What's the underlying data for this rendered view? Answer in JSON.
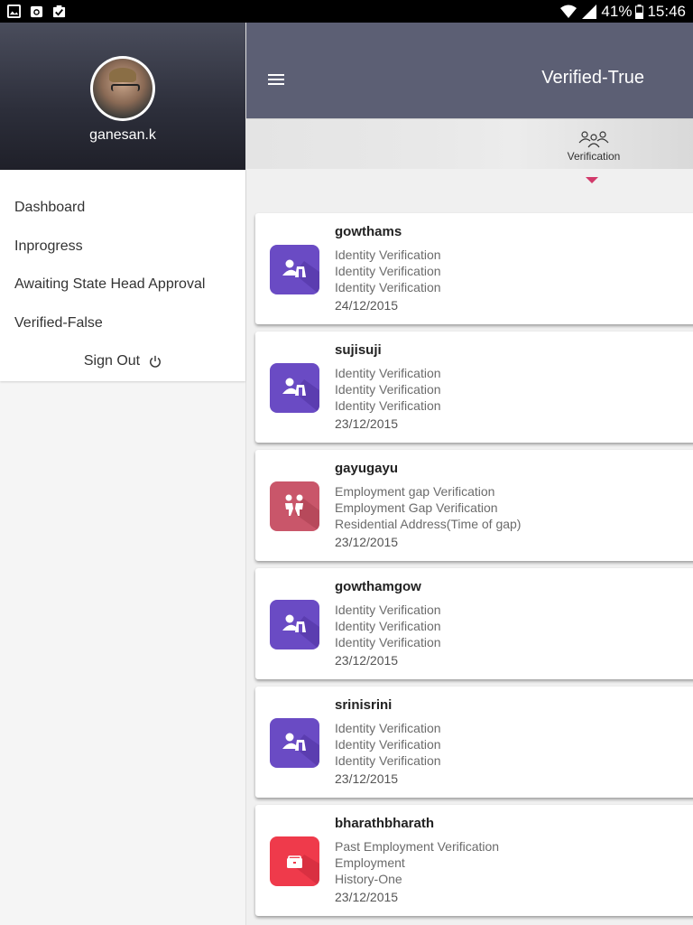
{
  "status_bar": {
    "icons_left": [
      "gallery-icon",
      "camera-icon",
      "clipboard-check-icon"
    ],
    "battery": "41%",
    "time": "15:46"
  },
  "drawer": {
    "username": "ganesan.k",
    "menu": [
      {
        "label": "Dashboard"
      },
      {
        "label": "Inprogress"
      },
      {
        "label": "Awaiting State Head Approval"
      },
      {
        "label": "Verified-False"
      }
    ],
    "sign_out": "Sign Out"
  },
  "toolbar": {
    "title": "Verified-True"
  },
  "tabs": [
    {
      "label": "Verification",
      "icon": "group-icon"
    }
  ],
  "colors": {
    "toolbar": "#5c5f74",
    "identity_icon": "#6a4bc4",
    "employment_gap_icon": "#c9566a",
    "past_employment_icon": "#ef3a4b",
    "tab_indicator": "#d23a6b"
  },
  "cards": [
    {
      "name": "gowthams",
      "lines": [
        "Identity Verification",
        "Identity Verification",
        "Identity Verification"
      ],
      "date": "24/12/2015",
      "icon": "identity-icon"
    },
    {
      "name": "sujisuji",
      "lines": [
        "Identity Verification",
        "Identity Verification",
        "Identity Verification"
      ],
      "date": "23/12/2015",
      "icon": "identity-icon"
    },
    {
      "name": "gayugayu",
      "lines": [
        "Employment gap Verification",
        "Employment Gap Verification",
        "Residential Address(Time of gap)"
      ],
      "date": "23/12/2015",
      "icon": "employment-gap-icon"
    },
    {
      "name": "gowthamgow",
      "lines": [
        "Identity Verification",
        "Identity Verification",
        "Identity Verification"
      ],
      "date": "23/12/2015",
      "icon": "identity-icon"
    },
    {
      "name": "srinisrini",
      "lines": [
        "Identity Verification",
        "Identity Verification",
        "Identity Verification"
      ],
      "date": "23/12/2015",
      "icon": "identity-icon"
    },
    {
      "name": "bharathbharath",
      "lines": [
        "Past Employment Verification",
        "Employment",
        "History-One"
      ],
      "date": "23/12/2015",
      "icon": "briefcase-icon"
    }
  ]
}
